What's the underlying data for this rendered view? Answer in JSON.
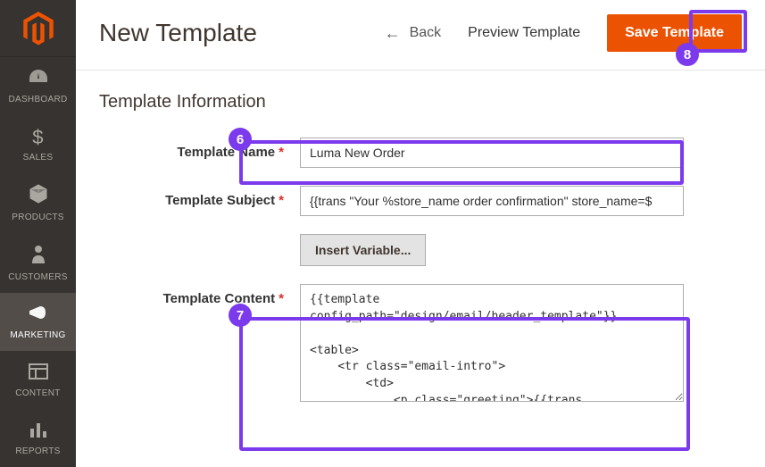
{
  "sidebar": {
    "items": [
      {
        "label": "DASHBOARD"
      },
      {
        "label": "SALES"
      },
      {
        "label": "PRODUCTS"
      },
      {
        "label": "CUSTOMERS"
      },
      {
        "label": "MARKETING"
      },
      {
        "label": "CONTENT"
      },
      {
        "label": "REPORTS"
      }
    ]
  },
  "header": {
    "title": "New Template",
    "back_label": "Back",
    "preview_label": "Preview Template",
    "save_label": "Save Template"
  },
  "section": {
    "title": "Template Information"
  },
  "form": {
    "name": {
      "label": "Template Name",
      "value": "Luma New Order"
    },
    "subject": {
      "label": "Template Subject",
      "value": "{{trans \"Your %store_name order confirmation\" store_name=$"
    },
    "insert_variable_label": "Insert Variable...",
    "content": {
      "label": "Template Content",
      "value": "{{template config_path=\"design/email/header_template\"}}\n\n<table>\n    <tr class=\"email-intro\">\n        <td>\n            <p class=\"greeting\">{{trans \"%customer_name,\" customer_name=$order.getCustomerName()}}</p>\n            <p>"
    }
  },
  "annotations": {
    "b6": "6",
    "b7": "7",
    "b8": "8"
  }
}
